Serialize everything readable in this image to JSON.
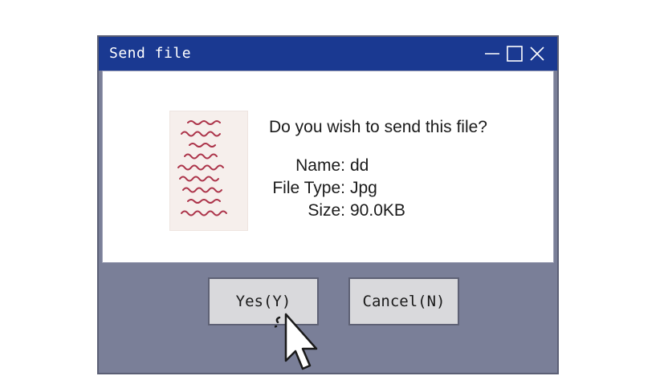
{
  "window": {
    "title": "Send file"
  },
  "dialog": {
    "question": "Do you wish to send this file?",
    "fields": [
      {
        "label": "Name:",
        "value": "dd"
      },
      {
        "label": "File Type:",
        "value": "Jpg"
      },
      {
        "label": "Size:",
        "value": "90.0KB"
      }
    ]
  },
  "buttons": {
    "yes_label": "Yes(Y)",
    "cancel_label": "Cancel(N)"
  },
  "icons": {
    "minimize": "minimize-icon",
    "maximize": "maximize-icon",
    "close": "close-icon",
    "cursor": "mouse-pointer-icon"
  },
  "colors": {
    "titlebar": "#1a3991",
    "window_body": "#7a7f98",
    "button_face": "#d9d9dc",
    "thumbnail_ink": "#a0142e"
  }
}
